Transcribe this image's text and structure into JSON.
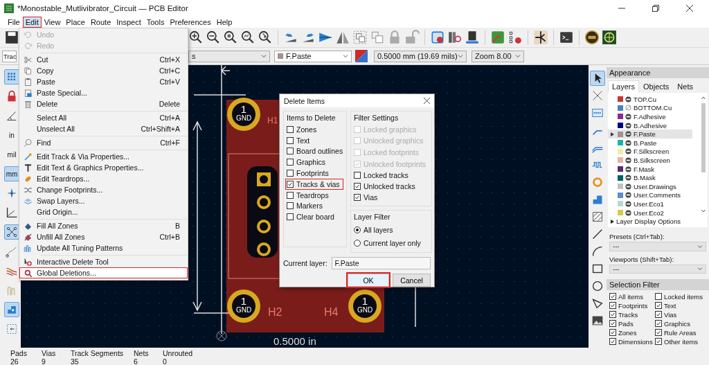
{
  "window": {
    "title": "*Monostable_Mutlivibrator_Circuit — PCB Editor"
  },
  "menu_bar": [
    {
      "label": "File",
      "selected": false
    },
    {
      "label": "Edit",
      "selected": true
    },
    {
      "label": "View",
      "selected": false
    },
    {
      "label": "Place",
      "selected": false
    },
    {
      "label": "Route",
      "selected": false
    },
    {
      "label": "Inspect",
      "selected": false
    },
    {
      "label": "Tools",
      "selected": false
    },
    {
      "label": "Preferences",
      "selected": false
    },
    {
      "label": "Help",
      "selected": false
    }
  ],
  "toolbar": {
    "track_width": "Trac",
    "via_size": "s",
    "layer": "F.Paste",
    "grid": "0.5000 mm (19.69 mils)",
    "zoom": "Zoom 8.00"
  },
  "left_toolbar": [
    {
      "kind": "tool",
      "selected": true
    },
    {
      "kind": "tool",
      "selected": false
    },
    {
      "kind": "tool",
      "selected": false
    },
    {
      "kind": "unit",
      "label": "in",
      "selected": false
    },
    {
      "kind": "unit",
      "label": "mil",
      "selected": false
    },
    {
      "kind": "unit",
      "label": "mm",
      "selected": true
    },
    {
      "kind": "tool",
      "selected": false
    },
    {
      "kind": "tool",
      "selected": false
    },
    {
      "kind": "tool",
      "selected": true
    },
    {
      "kind": "tool",
      "selected": false
    },
    {
      "kind": "tool",
      "selected": false
    },
    {
      "kind": "tool",
      "selected": false
    },
    {
      "kind": "tool",
      "selected": true
    },
    {
      "kind": "tool",
      "selected": false
    }
  ],
  "right_toolbar": [
    {
      "selected": true
    },
    {
      "selected": false
    },
    {
      "selected": false
    },
    {
      "selected": false
    },
    {
      "selected": false
    },
    {
      "selected": false
    },
    {
      "selected": false
    },
    {
      "selected": false
    },
    {
      "selected": false
    },
    {
      "selected": false
    },
    {
      "selected": false
    },
    {
      "selected": false
    },
    {
      "selected": false
    },
    {
      "selected": false
    },
    {
      "selected": false
    }
  ],
  "edit_menu": [
    {
      "kind": "item",
      "label": "Undo",
      "disabled": true,
      "highlighted": false
    },
    {
      "kind": "item",
      "label": "Redo",
      "disabled": true,
      "highlighted": false
    },
    {
      "kind": "separator"
    },
    {
      "kind": "item",
      "label": "Cut",
      "shortcut": "Ctrl+X",
      "disabled": false,
      "highlighted": false
    },
    {
      "kind": "item",
      "label": "Copy",
      "shortcut": "Ctrl+C",
      "disabled": false,
      "highlighted": false
    },
    {
      "kind": "item",
      "label": "Paste",
      "shortcut": "Ctrl+V",
      "disabled": false,
      "highlighted": false
    },
    {
      "kind": "item",
      "label": "Paste Special...",
      "disabled": false,
      "highlighted": false
    },
    {
      "kind": "item",
      "label": "Delete",
      "shortcut": "Delete",
      "disabled": false,
      "highlighted": false
    },
    {
      "kind": "separator"
    },
    {
      "kind": "item",
      "label": "Select All",
      "shortcut": "Ctrl+A",
      "disabled": false,
      "highlighted": false
    },
    {
      "kind": "item",
      "label": "Unselect All",
      "shortcut": "Ctrl+Shift+A",
      "disabled": false,
      "highlighted": false
    },
    {
      "kind": "separator"
    },
    {
      "kind": "item",
      "label": "Find",
      "shortcut": "Ctrl+F",
      "disabled": false,
      "highlighted": false
    },
    {
      "kind": "separator"
    },
    {
      "kind": "item",
      "label": "Edit Track & Via Properties...",
      "disabled": false,
      "highlighted": false
    },
    {
      "kind": "item",
      "label": "Edit Text & Graphics Properties...",
      "disabled": false,
      "highlighted": false
    },
    {
      "kind": "item",
      "label": "Edit Teardrops...",
      "disabled": false,
      "highlighted": false
    },
    {
      "kind": "item",
      "label": "Change Footprints...",
      "disabled": false,
      "highlighted": false
    },
    {
      "kind": "item",
      "label": "Swap Layers...",
      "disabled": false,
      "highlighted": false
    },
    {
      "kind": "item",
      "label": "Grid Origin...",
      "disabled": false,
      "highlighted": false
    },
    {
      "kind": "separator"
    },
    {
      "kind": "item",
      "label": "Fill All Zones",
      "shortcut": "B",
      "disabled": false,
      "highlighted": false
    },
    {
      "kind": "item",
      "label": "Unfill All Zones",
      "shortcut": "Ctrl+B",
      "disabled": false,
      "highlighted": false
    },
    {
      "kind": "item",
      "label": "Update All Tuning Patterns",
      "disabled": false,
      "highlighted": false
    },
    {
      "kind": "separator"
    },
    {
      "kind": "item",
      "label": "Interactive Delete Tool",
      "disabled": false,
      "highlighted": false
    },
    {
      "kind": "item",
      "label": "Global Deletions...",
      "disabled": false,
      "highlighted": true
    }
  ],
  "canvas": {
    "pads": [
      {
        "number": "1",
        "net": "GND",
        "reference": "H1"
      },
      {
        "number": "1",
        "net": "GND",
        "reference": "H2"
      },
      {
        "number": "1",
        "net": "GND",
        "reference": "H4"
      }
    ],
    "dimension": "0.5000 in"
  },
  "dialog": {
    "title": "Delete Items",
    "items_group": {
      "title": "Items to Delete",
      "options": [
        {
          "label": "Zones",
          "checked": false,
          "highlighted": false
        },
        {
          "label": "Text",
          "checked": false,
          "highlighted": false
        },
        {
          "label": "Board outlines",
          "checked": false,
          "highlighted": false
        },
        {
          "label": "Graphics",
          "checked": false,
          "highlighted": false
        },
        {
          "label": "Footprints",
          "checked": false,
          "highlighted": false
        },
        {
          "label": "Tracks & vias",
          "checked": true,
          "highlighted": true
        },
        {
          "label": "Teardrops",
          "checked": false,
          "highlighted": false
        },
        {
          "label": "Markers",
          "checked": false,
          "highlighted": false
        },
        {
          "label": "Clear board",
          "checked": false,
          "highlighted": false
        }
      ]
    },
    "filter_group": {
      "title": "Filter Settings",
      "options": [
        {
          "label": "Locked graphics",
          "checked": false,
          "disabled": true
        },
        {
          "label": "Unlocked graphics",
          "checked": false,
          "disabled": true
        },
        {
          "label": "Locked footprints",
          "checked": false,
          "disabled": true
        },
        {
          "label": "Unlocked footprints",
          "checked": true,
          "disabled": true
        },
        {
          "label": "Locked tracks",
          "checked": false,
          "disabled": false
        },
        {
          "label": "Unlocked tracks",
          "checked": true,
          "disabled": false
        },
        {
          "label": "Vias",
          "checked": true,
          "disabled": false
        }
      ]
    },
    "layer_filter": {
      "title": "Layer Filter",
      "options": [
        {
          "label": "All layers",
          "selected": true
        },
        {
          "label": "Current layer only",
          "selected": false
        }
      ]
    },
    "current_layer": {
      "label": "Current layer:",
      "value": "F.Paste"
    },
    "buttons": [
      {
        "label": "OK",
        "highlighted": true
      },
      {
        "label": "Cancel",
        "highlighted": false
      }
    ]
  },
  "appearance": {
    "title": "Appearance",
    "tabs": [
      {
        "label": "Layers",
        "selected": true
      },
      {
        "label": "Objects",
        "selected": false
      },
      {
        "label": "Nets",
        "selected": false
      }
    ],
    "layers": [
      {
        "name": "TOP.Cu",
        "color": "#c83434",
        "visible": true,
        "selected": false
      },
      {
        "name": "BOTTOM.Cu",
        "color": "#4d7fc4",
        "visible": false,
        "selected": false
      },
      {
        "name": "F.Adhesive",
        "color": "#8b2a8e",
        "visible": true,
        "selected": false
      },
      {
        "name": "B.Adhesive",
        "color": "#00007f",
        "visible": true,
        "selected": false
      },
      {
        "name": "F.Paste",
        "color": "#a09490",
        "visible": true,
        "selected": true
      },
      {
        "name": "B.Paste",
        "color": "#19b4a8",
        "visible": true,
        "selected": false
      },
      {
        "name": "F.Silkscreen",
        "color": "#f2eda1",
        "visible": true,
        "selected": false
      },
      {
        "name": "B.Silkscreen",
        "color": "#e8b2a7",
        "visible": true,
        "selected": false
      },
      {
        "name": "F.Mask",
        "color": "#5a2a6e",
        "visible": true,
        "selected": false
      },
      {
        "name": "B.Mask",
        "color": "#006060",
        "visible": true,
        "selected": false
      },
      {
        "name": "User.Drawings",
        "color": "#c2c2c2",
        "visible": true,
        "selected": false
      },
      {
        "name": "User.Comments",
        "color": "#5990cc",
        "visible": true,
        "selected": false
      },
      {
        "name": "User.Eco1",
        "color": "#b4dbd2",
        "visible": true,
        "selected": false
      },
      {
        "name": "User.Eco2",
        "color": "#d8c852",
        "visible": true,
        "selected": false
      }
    ],
    "display_options": "Layer Display Options",
    "presets": {
      "label": "Presets (Ctrl+Tab):",
      "value": "---"
    },
    "viewports": {
      "label": "Viewports (Shift+Tab):",
      "value": "---"
    },
    "selection_filter": {
      "title": "Selection Filter",
      "items": [
        {
          "label": "All items",
          "checked": true
        },
        {
          "label": "Locked items",
          "checked": false
        },
        {
          "label": "Footprints",
          "checked": true
        },
        {
          "label": "Text",
          "checked": true
        },
        {
          "label": "Tracks",
          "checked": true
        },
        {
          "label": "Vias",
          "checked": true
        },
        {
          "label": "Pads",
          "checked": true
        },
        {
          "label": "Graphics",
          "checked": true
        },
        {
          "label": "Zones",
          "checked": true
        },
        {
          "label": "Rule Areas",
          "checked": true
        },
        {
          "label": "Dimensions",
          "checked": true
        },
        {
          "label": "Other items",
          "checked": true
        }
      ]
    }
  },
  "status_bar": [
    {
      "label": "Pads",
      "value": "26"
    },
    {
      "label": "Vias",
      "value": "9"
    },
    {
      "label": "Track Segments",
      "value": "35"
    },
    {
      "label": "Nets",
      "value": "6"
    },
    {
      "label": "Unrouted",
      "value": "0"
    }
  ]
}
